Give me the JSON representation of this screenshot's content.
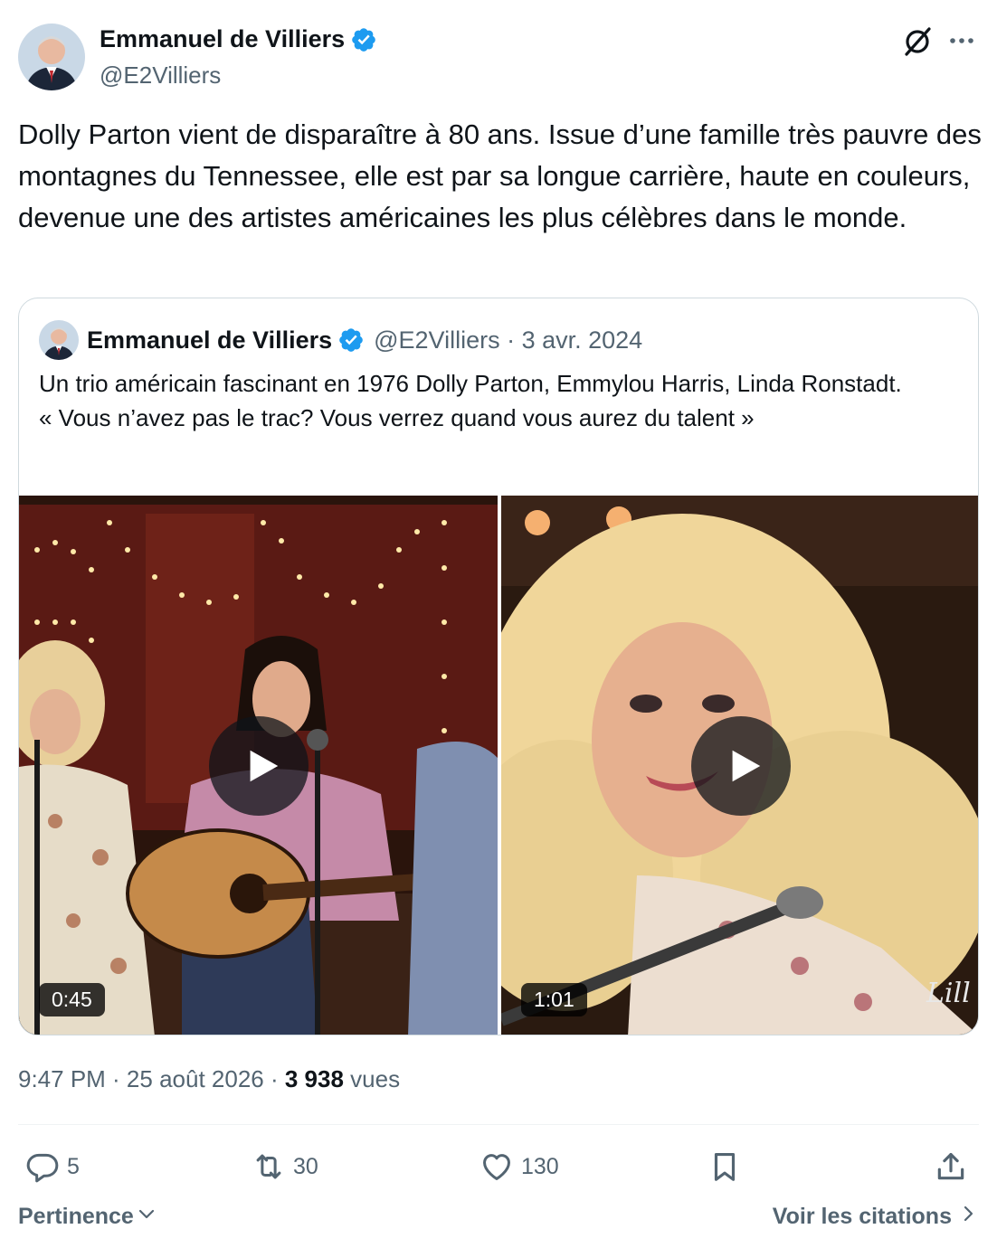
{
  "author": {
    "name": "Emmanuel de Villiers",
    "handle": "@E2Villiers",
    "verified": true
  },
  "tweet": {
    "text": "Dolly Parton vient de disparaître à 80 ans. Issue d’une famille très pauvre des montagnes du Tennessee, elle est par sa longue carrière, haute en couleurs, devenue une des artistes américaines les plus célèbres dans le monde."
  },
  "quote": {
    "name": "Emmanuel de Villiers",
    "meta": "@E2Villiers · 3 avr. 2024",
    "text_line1": "Un trio américain fascinant en 1976 Dolly Parton, Emmylou Harris, Linda Ronstadt.",
    "text_line2": "« Vous n’avez pas le trac? Vous verrez quand vous aurez du talent »",
    "videos": [
      {
        "duration": "0:45"
      },
      {
        "duration": "1:01"
      }
    ]
  },
  "meta": {
    "time_date": "9:47 PM · 25 août 2026 · ",
    "views_count": "3 938",
    "views_label": " vues"
  },
  "actions": {
    "replies": "5",
    "reposts": "30",
    "likes": "130"
  },
  "footer": {
    "sort_label": "Pertinence",
    "quotes_label": "Voir les citations"
  },
  "colors": {
    "text_primary": "#0f1419",
    "text_secondary": "#536471",
    "verified_blue": "#1d9bf0",
    "border": "#cfd9de"
  }
}
